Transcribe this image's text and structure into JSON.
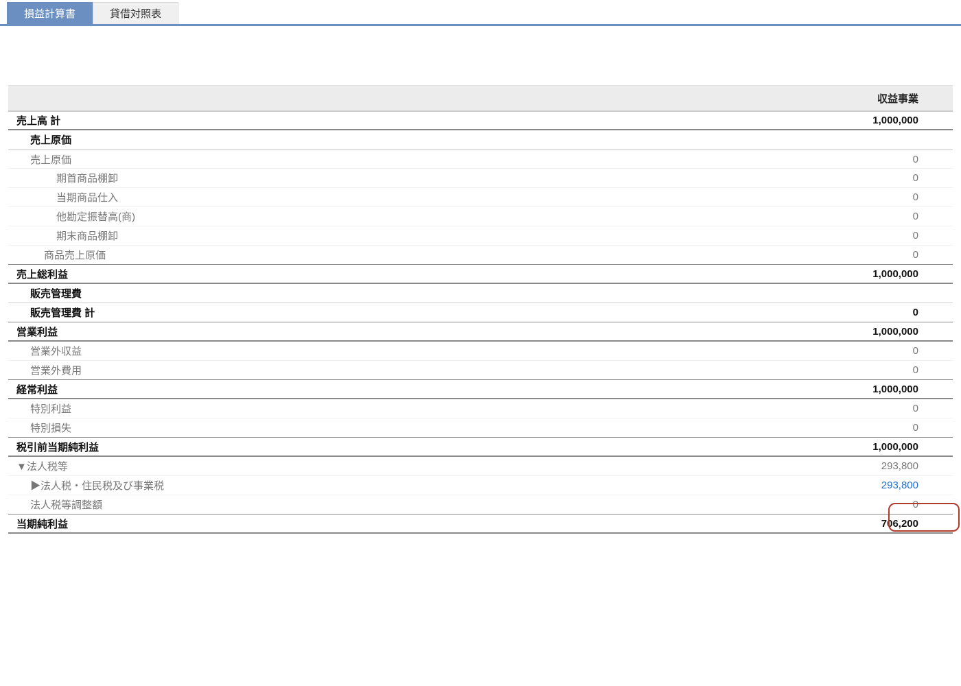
{
  "tabs": {
    "active": "損益計算書",
    "inactive": "貸借対照表"
  },
  "column_header": "収益事業",
  "rows": [
    {
      "label": "売上高 計",
      "value": "1,000,000",
      "cls": "bold rule-strong rule-liteTop",
      "indent": 0
    },
    {
      "label": "売上原価",
      "value": "",
      "cls": "bold indent-1",
      "indent": 1
    },
    {
      "label": "売上原価",
      "value": "0",
      "cls": "muted indent-1 rule-liteTop",
      "indent": 1
    },
    {
      "label": "期首商品棚卸",
      "value": "0",
      "cls": "muted indent-3",
      "indent": 3
    },
    {
      "label": "当期商品仕入",
      "value": "0",
      "cls": "muted indent-3",
      "indent": 3
    },
    {
      "label": "他勘定振替高(商)",
      "value": "0",
      "cls": "muted indent-3",
      "indent": 3
    },
    {
      "label": "期末商品棚卸",
      "value": "0",
      "cls": "muted indent-3",
      "indent": 3
    },
    {
      "label": "商品売上原価",
      "value": "0",
      "cls": "muted indent-2 rule-mid",
      "indent": 2
    },
    {
      "label": "売上総利益",
      "value": "1,000,000",
      "cls": "bold rule-strong",
      "indent": 0
    },
    {
      "label": "販売管理費",
      "value": "",
      "cls": "bold indent-1 rule-lite",
      "indent": 1
    },
    {
      "label": "販売管理費 計",
      "value": "0",
      "cls": "bold indent-1 rule-mid",
      "indent": 1
    },
    {
      "label": "営業利益",
      "value": "1,000,000",
      "cls": "bold rule-strong",
      "indent": 0
    },
    {
      "label": "営業外収益",
      "value": "0",
      "cls": "muted indent-1",
      "indent": 1
    },
    {
      "label": "営業外費用",
      "value": "0",
      "cls": "muted indent-1 rule-mid",
      "indent": 1
    },
    {
      "label": "経常利益",
      "value": "1,000,000",
      "cls": "bold rule-strong",
      "indent": 0
    },
    {
      "label": "特別利益",
      "value": "0",
      "cls": "muted indent-1",
      "indent": 1
    },
    {
      "label": "特別損失",
      "value": "0",
      "cls": "muted indent-1 rule-mid",
      "indent": 1
    },
    {
      "label": "税引前当期純利益",
      "value": "1,000,000",
      "cls": "bold rule-strong",
      "indent": 0
    },
    {
      "label": "▼法人税等",
      "value": "293,800",
      "cls": "muted",
      "indent": 0
    },
    {
      "label": "▶法人税・住民税及び事業税",
      "value": "293,800",
      "cls": "muted link indent-1",
      "indent": 1
    },
    {
      "label": "法人税等調整額",
      "value": "0",
      "cls": "muted indent-1 rule-mid",
      "indent": 1
    },
    {
      "label": "当期純利益",
      "value": "706,200",
      "cls": "bold rule-strong",
      "indent": 0
    }
  ],
  "highlight_value": "706,200"
}
